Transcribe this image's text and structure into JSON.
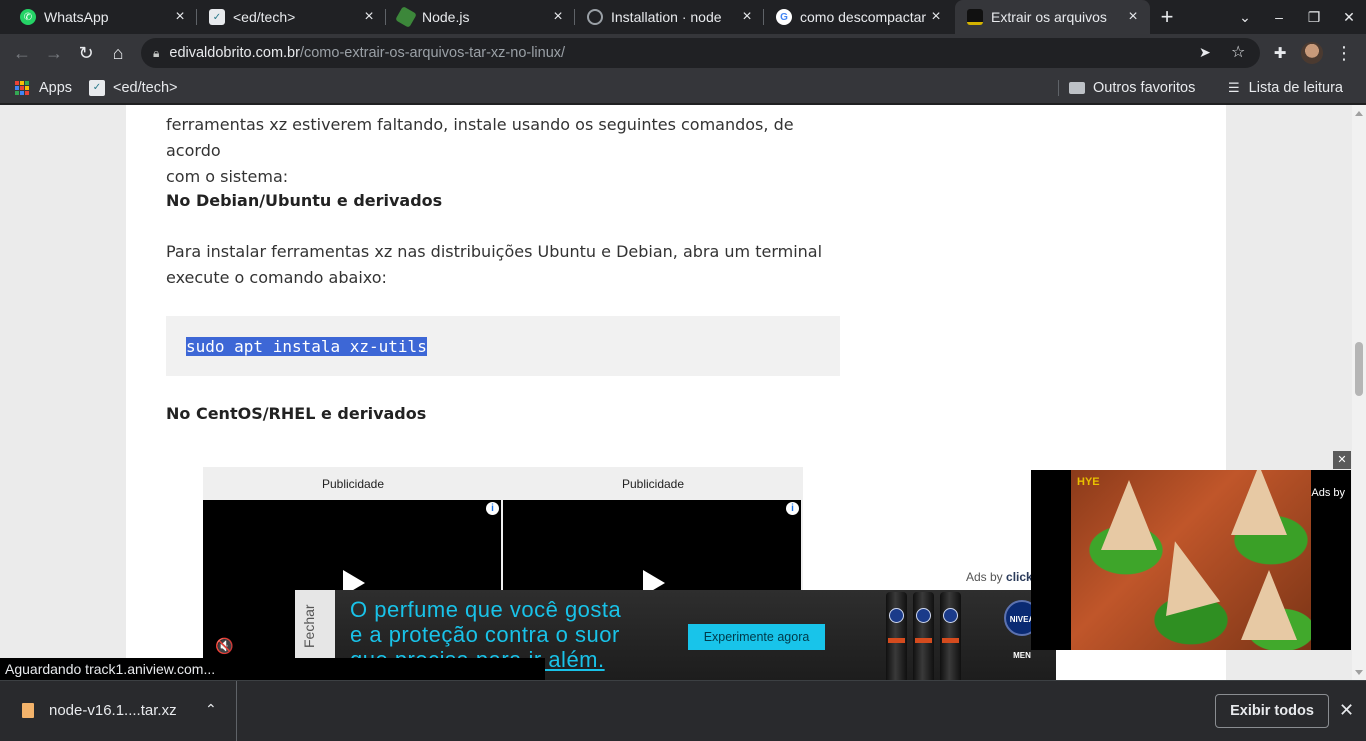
{
  "tabs": [
    {
      "title": "WhatsApp",
      "close": "×"
    },
    {
      "title": "<ed/tech>",
      "close": "×"
    },
    {
      "title": "Node.js",
      "close": "×"
    },
    {
      "title": "Installation · node",
      "close": "×"
    },
    {
      "title": "como descompactar",
      "close": "×"
    },
    {
      "title": "Extrair os arquivos",
      "close": "×"
    }
  ],
  "window": {
    "new_tab": "+",
    "tab_search": "⌄",
    "minimize": "–",
    "maximize": "❐",
    "close": "✕"
  },
  "toolbar": {
    "back": "←",
    "forward": "→",
    "reload": "↻",
    "home": "⌂",
    "url_host": "edivaldobrito.com.br",
    "url_path": "/como-extrair-os-arquivos-tar-xz-no-linux/",
    "send_icon": "➤",
    "star_icon": "☆",
    "extensions_icon": "✚",
    "menu_icon": "⋮"
  },
  "bookmarks": {
    "apps": "Apps",
    "edtech": "<ed/tech>",
    "other_favorites": "Outros favoritos",
    "reading_list": "Lista de leitura"
  },
  "article": {
    "intro_lines": [
      "ferramentas xz estiverem faltando, instale usando os seguintes comandos, de acordo",
      "com o sistema:"
    ],
    "heading_debian": "No Debian/Ubuntu e derivados",
    "para_debian": [
      "Para instalar ferramentas xz nas distribuições Ubuntu e Debian, abra um terminal",
      "execute o comando abaixo:"
    ],
    "code": "sudo apt instala xz-utils",
    "heading_centos": "No CentOS/RHEL e derivados"
  },
  "ads": {
    "label_left": "Publicidade",
    "label_right": "Publicidade",
    "info": "i",
    "mute": "🔇",
    "adsby_prefix": "Ads by",
    "adsby_brand": "click",
    "banner_close": "Fechar",
    "banner_line1": "O perfume que você gosta",
    "banner_line2": "e a proteção contra o suor",
    "banner_line3": "que precisa para ir além.",
    "banner_cta": "Experimente agora",
    "brand_logo": "NIVEA MEN",
    "float_close": "✕",
    "float_adsby": "Ads by",
    "float_badge": "HYE"
  },
  "status": "Aguardando track1.aniview.com...",
  "downloads": {
    "file": "node-v16.1....tar.xz",
    "chevron": "⌃",
    "show_all": "Exibir todos",
    "close": "✕"
  }
}
